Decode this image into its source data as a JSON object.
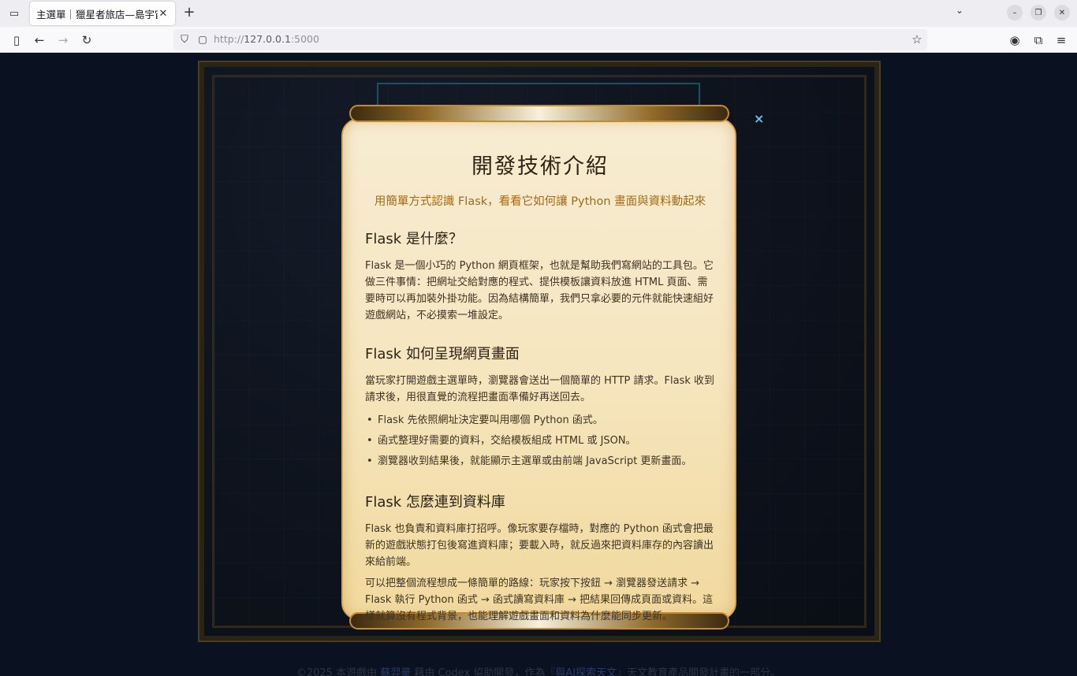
{
  "browser": {
    "tab_title": "主選單｜獵星者旅店—島宇宙",
    "url_prefix": "http://",
    "url_host": "127.0.0.1",
    "url_suffix": ":5000"
  },
  "footer": {
    "prefix": "©2025 本遊戲由 ",
    "author": "蘇羿豪",
    "mid": " 藉由 Codex 協助開發，作為『",
    "project": "與AI探索天文",
    "suffix": "』天文教育產品開發計畫的一部分。"
  },
  "modal": {
    "close_label": "×",
    "title": "開發技術介紹",
    "subtitle": "用簡單方式認識 Flask，看看它如何讓 Python 畫面與資料動起來",
    "sections": [
      {
        "heading": "Flask 是什麼？",
        "paragraph": "Flask 是一個小巧的 Python 網頁框架，也就是幫助我們寫網站的工具包。它做三件事情：把網址交給對應的程式、提供模板讓資料放進 HTML 頁面、需要時可以再加裝外掛功能。因為結構簡單，我們只拿必要的元件就能快速組好遊戲網站，不必摸索一堆設定。"
      },
      {
        "heading": "Flask 如何呈現網頁畫面",
        "paragraph": "當玩家打開遊戲主選單時，瀏覽器會送出一個簡單的 HTTP 請求。Flask 收到請求後，用很直覺的流程把畫面準備好再送回去。",
        "bullets": [
          "Flask 先依照網址決定要叫用哪個 Python 函式。",
          "函式整理好需要的資料，交給模板組成 HTML 或 JSON。",
          "瀏覽器收到結果後，就能顯示主選單或由前端 JavaScript 更新畫面。"
        ]
      },
      {
        "heading": "Flask 怎麼連到資料庫",
        "paragraph": "Flask 也負責和資料庫打招呼。像玩家要存檔時，對應的 Python 函式會把最新的遊戲狀態打包後寫進資料庫；要載入時，就反過來把資料庫存的內容讀出來給前端。",
        "paragraph2": "可以把整個流程想成一條簡單的路線：玩家按下按鈕 → 瀏覽器發送請求 → Flask 執行 Python 函式 → 函式讀寫資料庫 → 把結果回傳成頁面或資料。這樣就算沒有程式背景，也能理解遊戲畫面和資料為什麼能同步更新。"
      }
    ]
  }
}
